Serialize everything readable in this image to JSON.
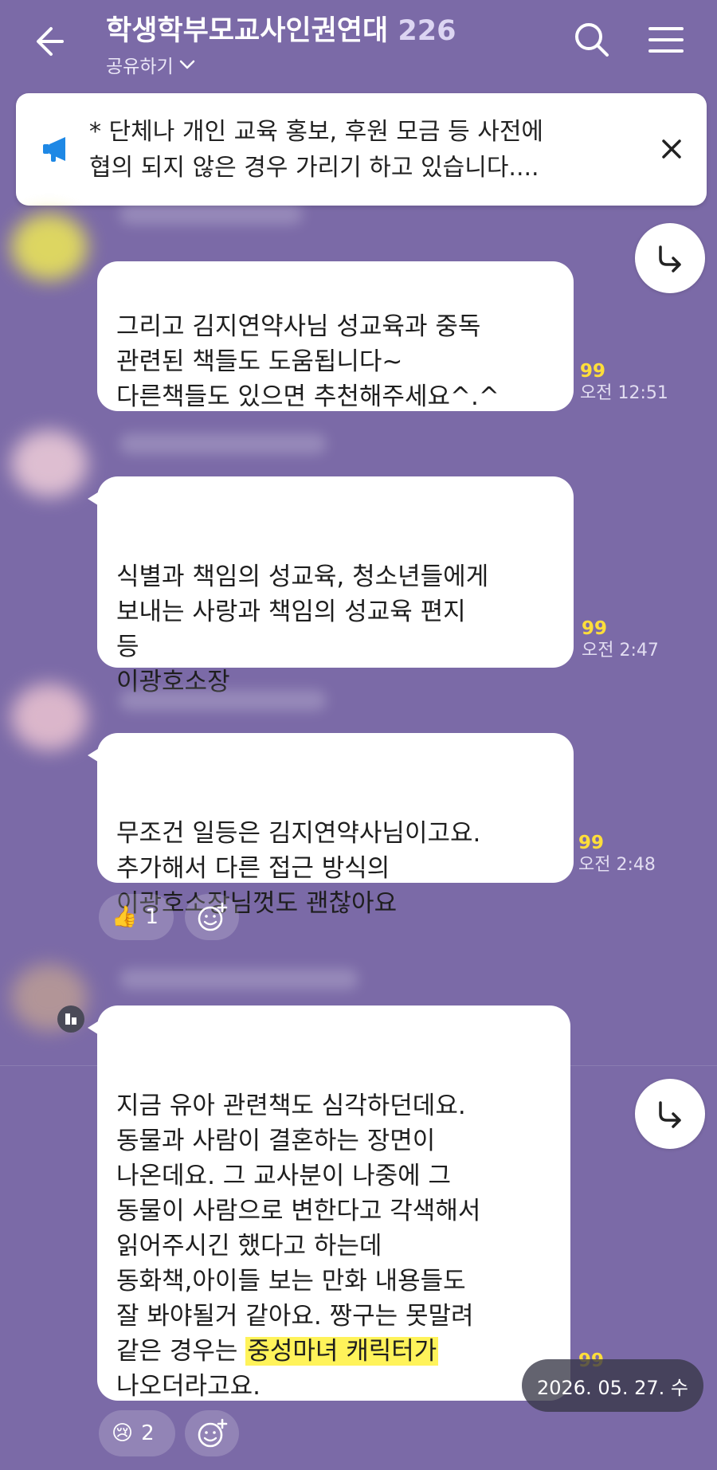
{
  "header": {
    "title": "학생학부모교사인권연대",
    "member_count": "226",
    "subtitle": "공유하기",
    "icons": [
      "back-arrow-icon",
      "search-icon",
      "menu-icon"
    ]
  },
  "notice": {
    "text": "* 단체나 개인 교육 홍보, 후원 모금 등 사전에\n협의 되지 않은 경우 가리기 하고 있습니다....",
    "icon": "megaphone-icon"
  },
  "messages": [
    {
      "text": "그리고 김지연약사님 성교육과 중독\n관련된 책들도 도움됩니다~\n다른책들도 있으면 추천해주세요^.^",
      "unread": "99",
      "time": "오전 12:51"
    },
    {
      "text": "식별과 책임의 성교육, 청소년들에게\n보내는 사랑과 책임의 성교육 편지\n등\n이광호소장",
      "unread": "99",
      "time": "오전 2:47"
    },
    {
      "text": "무조건 일등은 김지연약사님이고요.\n추가해서 다른 접근 방식의\n이광호소장님껏도 괜찮아요",
      "unread": "99",
      "time": "오전 2:48",
      "reaction": {
        "emoji": "👍",
        "count": "1"
      }
    },
    {
      "text_before": "지금 유아 관련책도 심각하던데요.\n동물과 사람이 결혼하는 장면이\n나온데요. 그 교사분이 나중에 그\n동물이 사람으로 변한다고 각색해서\n읽어주시긴 했다고 하는데\n동화책,아이들 보는 만화 내용들도\n잘 봐야될거 같아요. 짱구는 못말려\n같은 경우는 ",
      "text_highlight": "중성마녀 캐릭터가",
      "text_after": "\n나오더라고요.",
      "unread": "99",
      "reaction": {
        "emoji": "😢",
        "count": "2"
      }
    }
  ],
  "date_pill": "2026. 05. 27. 수",
  "colors": {
    "background": "#7b6aa7",
    "unread": "#ffde3a",
    "highlight": "#fff35a",
    "notice_icon": "#1e88e5"
  }
}
